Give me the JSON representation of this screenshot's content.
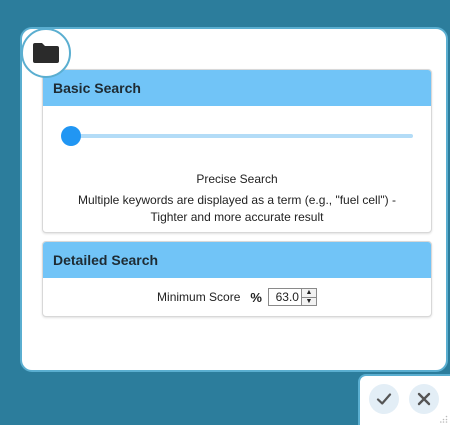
{
  "icons": {
    "folder": "folder-icon",
    "percent": "percent-icon",
    "confirm": "checkmark-icon",
    "cancel": "close-icon"
  },
  "colors": {
    "background": "#2c7d9c",
    "panel_border": "#5aaed0",
    "card_header": "#71c4f7",
    "slider_thumb": "#2196f3",
    "slider_track": "#b3dcf7"
  },
  "basic_search": {
    "title": "Basic Search",
    "slider_level": 0,
    "mode_title": "Precise Search",
    "mode_description": "Multiple keywords are displayed as a term (e.g., \"fuel cell\") - Tighter and more accurate result"
  },
  "detailed_search": {
    "title": "Detailed Search",
    "min_score_label": "Minimum Score",
    "percent_symbol": "%",
    "min_score_value": "63.0",
    "spin_up": "▲",
    "spin_down": "▼"
  }
}
